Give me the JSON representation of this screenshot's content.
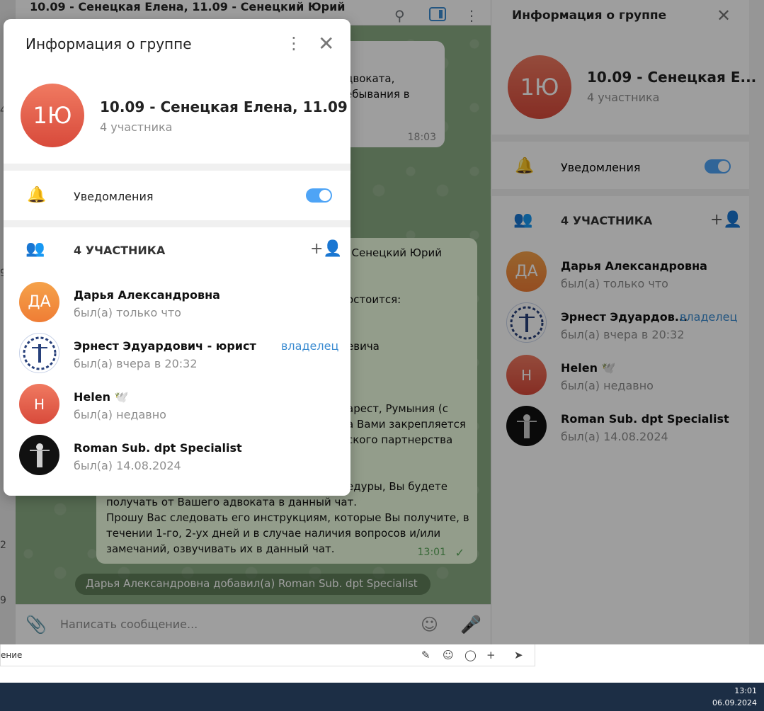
{
  "chat": {
    "title": "10.09 - Сенецкая Елена, 11.09 - Сенецкий Юрий",
    "msg1": {
      "line1": "двоката,",
      "line2": "ебывания в",
      "time": "18:03"
    },
    "msg2": {
      "lines": [
        "и Сенецкий Юрий",
        "остоится:",
        "евича",
        "арест, Румыния (с",
        "а Вами закрепляется",
        "ского партнерства",
        "едуры, Вы будете",
        "получать от Вашего адвоката в данный чат.",
        "Прошу Вас следовать его инструкциям, которые Вы получите, в",
        "течении 1-го, 2-ух дней и в случае наличия вопросов и/или",
        "замечаний, озвучивать их в данный чат."
      ],
      "time": "13:01",
      "check": "✓"
    },
    "system_message": "Дарья Александровна добавил(а) Roman Sub. dpt Specialist",
    "input_placeholder": "Написать сообщение..."
  },
  "left_strip_numbers": [
    "4",
    "9",
    "2",
    "9"
  ],
  "bottom_bar": {
    "text": "ение"
  },
  "side_panel": {
    "title": "Информация о группе",
    "group_name": "10.09 - Сенецкая Е...",
    "members_count": "4 участника",
    "avatar_initials": "1Ю",
    "notifications_label": "Уведомления",
    "members_header": "4 УЧАСТНИКА",
    "members": [
      {
        "initials": "ДА",
        "name": "Дарья Александровна",
        "status": "был(а) только что"
      },
      {
        "initials": "",
        "name": "Эрнест Эдуардов...",
        "status": "был(а) вчера в 20:32",
        "role": "владелец"
      },
      {
        "initials": "H",
        "name": "Helen 🕊️",
        "status": "был(а) недавно"
      },
      {
        "initials": "",
        "name": "Roman Sub. dpt Specialist",
        "status": "был(а) 14.08.2024"
      }
    ]
  },
  "modal": {
    "title": "Информация о группе",
    "group_name": "10.09 - Сенецкая Елена, 11.09 - ...",
    "members_count": "4 участника",
    "avatar_initials": "1Ю",
    "notifications_label": "Уведомления",
    "notifications_on": true,
    "members_header": "4 УЧАСТНИКА",
    "members": [
      {
        "initials": "ДА",
        "name": "Дарья Александровна",
        "status": "был(а) только что"
      },
      {
        "initials": "",
        "name": "Эрнест Эдуардович - юрист",
        "status": "был(а) вчера в 20:32",
        "role": "владелец"
      },
      {
        "initials": "H",
        "name": "Helen 🕊️",
        "status": "был(а) недавно"
      },
      {
        "initials": "",
        "name": "Roman Sub. dpt Specialist",
        "status": "был(а) 14.08.2024"
      }
    ]
  },
  "taskbar": {
    "time": "13:01",
    "date": "06.09.2024"
  },
  "colors": {
    "accent": "#4ea4f6",
    "owner": "#3a8bd1",
    "chat_bg": "#8aab83"
  }
}
